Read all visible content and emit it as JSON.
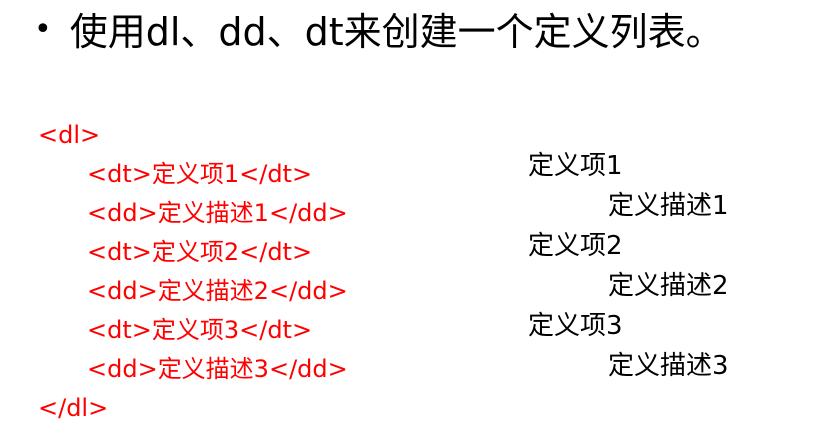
{
  "heading": {
    "bullet": "•",
    "text": "使用dl、dd、dt来创建一个定义列表。"
  },
  "code": {
    "open": "<dl>",
    "lines": [
      "<dt>定义项1</dt>",
      "<dd>定义描述1</dd>",
      "<dt>定义项2</dt>",
      "<dd>定义描述2</dd>",
      "<dt>定义项3</dt>",
      "<dd>定义描述3</dd>"
    ],
    "close": "</dl>"
  },
  "preview": {
    "items": [
      {
        "term": "定义项1",
        "desc": "定义描述1"
      },
      {
        "term": "定义项2",
        "desc": "定义描述2"
      },
      {
        "term": "定义项3",
        "desc": "定义描述3"
      }
    ]
  },
  "colors": {
    "code": "#ff0000",
    "text": "#000000",
    "background": "#ffffff"
  }
}
